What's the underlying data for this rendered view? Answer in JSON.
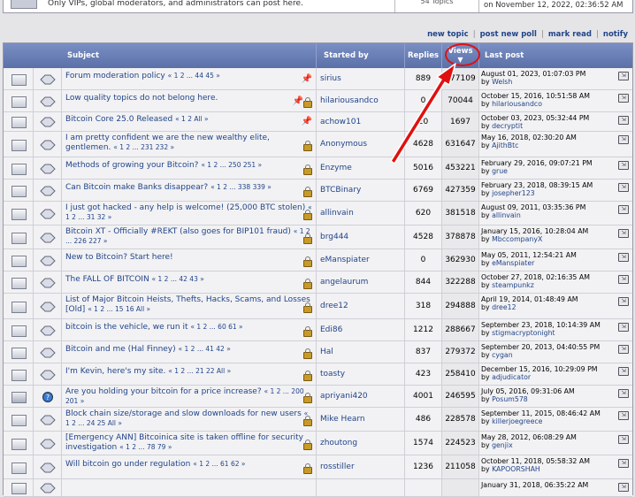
{
  "top": {
    "message": "Only VIPs, global moderators, and administrators can post here.",
    "topics": "54 Topics",
    "last": "on November 12, 2022, 02:36:52 AM"
  },
  "nav": {
    "new_topic": "new topic",
    "new_poll": "post new poll",
    "mark_read": "mark read",
    "notify": "notify"
  },
  "header": {
    "subject": "Subject",
    "started_by": "Started by",
    "replies": "Replies",
    "views": "Views",
    "views_caret": "▼",
    "last_post": "Last post"
  },
  "rows": [
    {
      "title": "Forum moderation policy",
      "pages": "« 1 2 ... 44 45 »",
      "starter": "sirius",
      "replies": "889",
      "views": "177109",
      "date": "August 01, 2023, 01:07:03 PM",
      "by": "by",
      "user": "Welsh",
      "flag": "pin"
    },
    {
      "title": "Low quality topics do not belong here.",
      "pages": "",
      "starter": "hilariousandco",
      "replies": "0",
      "views": "70044",
      "date": "October 15, 2016, 10:51:58 AM",
      "by": "by",
      "user": "hilariousandco",
      "flag": "pinlock"
    },
    {
      "title": "Bitcoin Core 25.0 Released",
      "pages": "« 1 2  All »",
      "starter": "achow101",
      "replies": "20",
      "views": "1697",
      "date": "October 03, 2023, 05:32:44 PM",
      "by": "by",
      "user": "decryptit",
      "flag": "pin"
    },
    {
      "title": "I am pretty confident we are the new wealthy elite, gentlemen.",
      "pages": "« 1 2 ... 231 232 »",
      "starter": "Anonymous",
      "replies": "4628",
      "views": "631647",
      "date": "May 16, 2018, 02:30:20 AM",
      "by": "by",
      "user": "AjithBtc",
      "flag": "lock"
    },
    {
      "title": "Methods of growing your Bitcoin?",
      "pages": "« 1 2 ... 250 251 »",
      "starter": "Enzyme",
      "replies": "5016",
      "views": "453221",
      "date": "February 29, 2016, 09:07:21 PM",
      "by": "by",
      "user": "grue",
      "flag": "lock"
    },
    {
      "title": "Can Bitcoin make Banks disappear?",
      "pages": "« 1 2 ... 338 339 »",
      "starter": "BTCBinary",
      "replies": "6769",
      "views": "427359",
      "date": "February 23, 2018, 08:39:15 AM",
      "by": "by",
      "user": "josepher123",
      "flag": "lock"
    },
    {
      "title": "I just got hacked - any help is welcome! (25,000 BTC stolen)",
      "pages": "« 1 2 ... 31 32 »",
      "starter": "allinvain",
      "replies": "620",
      "views": "381518",
      "date": "August 09, 2011, 03:35:36 PM",
      "by": "by",
      "user": "allinvain",
      "flag": "lock"
    },
    {
      "title": "Bitcoin XT - Officially #REKT (also goes for BIP101 fraud)",
      "pages": "« 1 2 ... 226 227 »",
      "starter": "brg444",
      "replies": "4528",
      "views": "378878",
      "date": "January 15, 2016, 10:28:04 AM",
      "by": "by",
      "user": "MbccompanyX",
      "flag": "lock"
    },
    {
      "title": "New to Bitcoin? Start here!",
      "pages": "",
      "starter": "eManspiater",
      "replies": "0",
      "views": "362930",
      "date": "May 05, 2011, 12:54:21 AM",
      "by": "by",
      "user": "eManspiater",
      "flag": "lock"
    },
    {
      "title": "The FALL OF BITCOIN",
      "pages": "« 1 2 ... 42 43 »",
      "starter": "angelaurum",
      "replies": "844",
      "views": "322288",
      "date": "October 27, 2018, 02:16:35 AM",
      "by": "by",
      "user": "steampunkz",
      "flag": "lock"
    },
    {
      "title": "List of Major Bitcoin Heists, Thefts, Hacks, Scams, and Losses [Old]",
      "pages": "« 1 2 ... 15 16  All »",
      "starter": "dree12",
      "replies": "318",
      "views": "294888",
      "date": "April 19, 2014, 01:48:49 AM",
      "by": "by",
      "user": "dree12",
      "flag": "lock"
    },
    {
      "title": "bitcoin is the vehicle, we run it",
      "pages": "« 1 2 ... 60 61 »",
      "starter": "Edi86",
      "replies": "1212",
      "views": "288667",
      "date": "September 23, 2018, 10:14:39 AM",
      "by": "by",
      "user": "stigmacryptonight",
      "flag": "lock"
    },
    {
      "title": "Bitcoin and me (Hal Finney)",
      "pages": "« 1 2 ... 41 42 »",
      "starter": "Hal",
      "replies": "837",
      "views": "279372",
      "date": "September 20, 2013, 04:40:55 PM",
      "by": "by",
      "user": "cygan",
      "flag": "lock"
    },
    {
      "title": "I'm Kevin, here's my site.",
      "pages": "« 1 2 ... 21 22  All »",
      "starter": "toasty",
      "replies": "423",
      "views": "258410",
      "date": "December 15, 2016, 10:29:09 PM",
      "by": "by",
      "user": "adjudicator",
      "flag": "lock"
    },
    {
      "title": "Are you holding your bitcoin for a price increase?",
      "pages": "« 1 2 ... 200 201 »",
      "starter": "apriyani420",
      "replies": "4001",
      "views": "246595",
      "date": "July 05, 2016, 09:31:06 AM",
      "by": "by",
      "user": "Posum578",
      "flag": "lock"
    },
    {
      "title": "Block chain size/storage and slow downloads for new users",
      "pages": "« 1 2 ... 24 25  All »",
      "starter": "Mike Hearn",
      "replies": "486",
      "views": "228578",
      "date": "September 11, 2015, 08:46:42 AM",
      "by": "by",
      "user": "killerjoegreece",
      "flag": "lock"
    },
    {
      "title": "[Emergency ANN] Bitcoinica site is taken offline for security investigation",
      "pages": "« 1 2 ... 78 79 »",
      "starter": "zhoutong",
      "replies": "1574",
      "views": "224523",
      "date": "May 28, 2012, 06:08:29 AM",
      "by": "by",
      "user": "genjix",
      "flag": "lock"
    },
    {
      "title": "Will bitcoin go under regulation",
      "pages": "« 1 2 ... 61 62 »",
      "starter": "rosstiller",
      "replies": "1236",
      "views": "211058",
      "date": "October 11, 2018, 05:58:32 AM",
      "by": "by",
      "user": "KAPOORSHAH",
      "flag": "lock"
    },
    {
      "title": "",
      "pages": "",
      "starter": "",
      "replies": "",
      "views": "",
      "date": "January 31, 2018, 06:35:22 AM",
      "by": "",
      "user": "",
      "flag": "none"
    }
  ]
}
